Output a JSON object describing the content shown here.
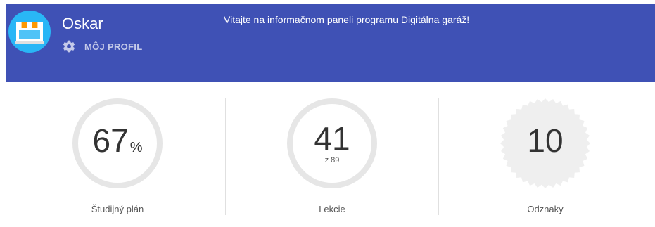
{
  "header": {
    "user_name": "Oskar",
    "profile_label": "MÔJ PROFIL",
    "welcome_text": "Vitajte na informačnom paneli programu Digitálna garáž!",
    "background_color": "#3f51b5",
    "avatar_icon": "storefront-icon",
    "profile_icon": "gear-icon"
  },
  "stats": [
    {
      "value": "67",
      "unit": "%",
      "caption": "Študijný plán",
      "progress_percent": 67
    },
    {
      "value": "41",
      "sub": "z 89",
      "caption": "Lekcie",
      "completed": 41,
      "total": 89
    },
    {
      "value": "10",
      "caption": "Odznaky"
    }
  ]
}
